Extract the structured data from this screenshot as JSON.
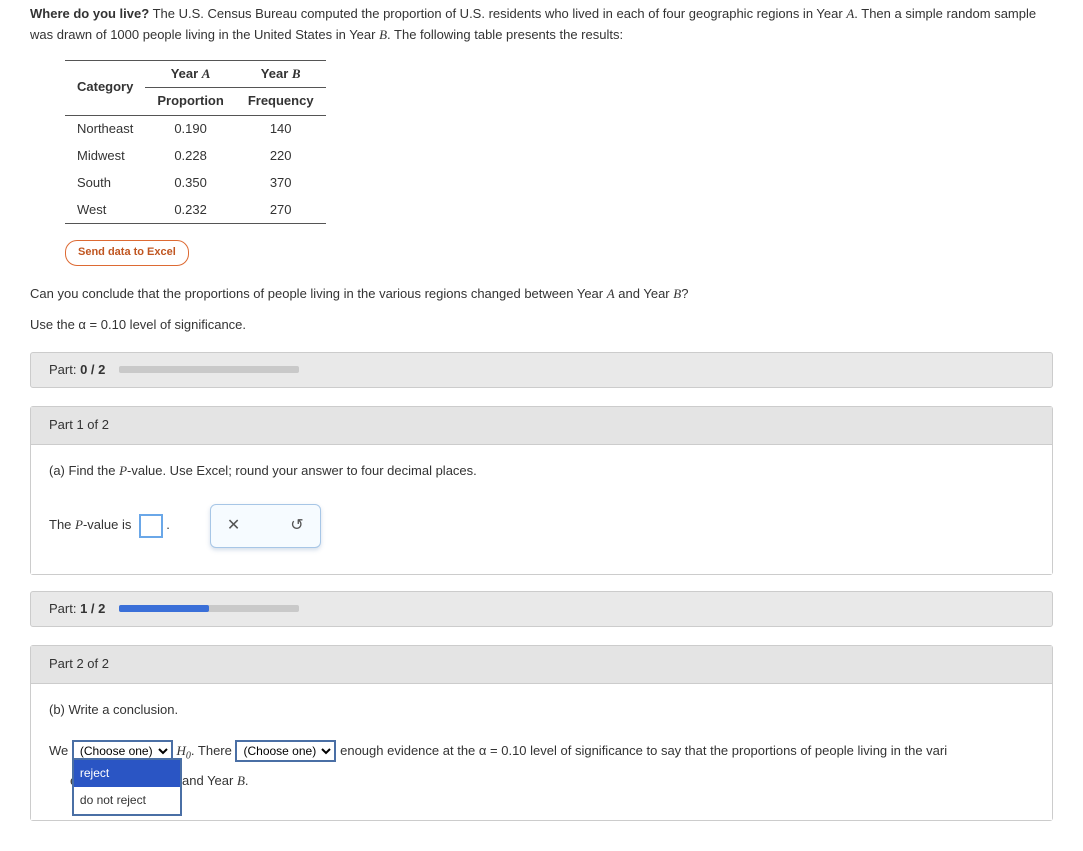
{
  "intro": {
    "title": "Where do you live?",
    "text1": " The U.S. Census Bureau computed the proportion of U.S. residents who lived in each of four geographic regions in Year ",
    "yearA": "A",
    "text2": ". Then a simple random sample was drawn of ",
    "sample": "1000",
    "text3": " people living in the United States in Year ",
    "yearB": "B",
    "text4": ". The following table presents the results:"
  },
  "table": {
    "headers": {
      "cat": "Category",
      "colA_top": "Year A",
      "colA_bot": "Proportion",
      "colB_top": "Year B",
      "colB_bot": "Frequency"
    },
    "rows": [
      {
        "cat": "Northeast",
        "prop": "0.190",
        "freq": "140"
      },
      {
        "cat": "Midwest",
        "prop": "0.228",
        "freq": "220"
      },
      {
        "cat": "South",
        "prop": "0.350",
        "freq": "370"
      },
      {
        "cat": "West",
        "prop": "0.232",
        "freq": "270"
      }
    ]
  },
  "excel_btn": "Send data to Excel",
  "question": {
    "q1a": "Can you conclude that the proportions of people living in the various regions changed between Year ",
    "q1b": " and Year ",
    "q1c": "?",
    "sig1": "Use the α = ",
    "alpha": "0.10",
    "sig2": " level of significance."
  },
  "progress": {
    "p0_label": "Part: ",
    "p0_val": "0 / 2",
    "p1_label": "Part: ",
    "p1_val": "1 / 2"
  },
  "part1": {
    "header": "Part 1 of 2",
    "prompt": "(a) Find the P-value. Use Excel; round your answer to four decimal places.",
    "answer_pre": "The P-value is",
    "answer_post": "."
  },
  "part2": {
    "header": "Part 2 of 2",
    "prompt": "(b) Write a conclusion.",
    "line": {
      "we": "We",
      "choose": "(Choose one)",
      "h0": "H",
      "h0sub": "0",
      "there": ". There",
      "after": "enough evidence at the α = ",
      "alpha": "0.10",
      "tail": " level of significance to say that the proportions of people living in the vari",
      "tail2": "ed between Year ",
      "tail3": " and Year ",
      "tail4": "."
    },
    "options": {
      "o1": "reject",
      "o2": "do not reject"
    }
  }
}
